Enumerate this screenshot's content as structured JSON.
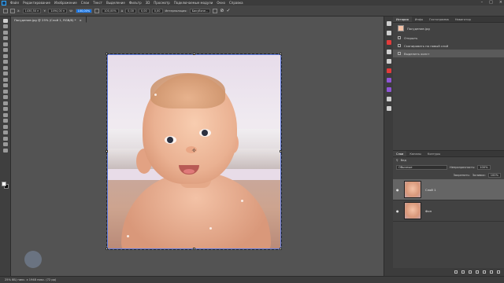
{
  "menu": {
    "items": [
      "Файл",
      "Редактирование",
      "Изображение",
      "Слои",
      "Текст",
      "Выделение",
      "Фильтр",
      "3D",
      "Просмотр",
      "Подключаемые модули",
      "Окно",
      "Справка"
    ],
    "window_controls": [
      "–",
      "□",
      "×"
    ]
  },
  "options": {
    "x_label": "X:",
    "x_value": "1430,50 п",
    "y_label": "Y:",
    "y_value": "1494,00 п",
    "w_label": "W:",
    "w_value": "100,00%",
    "h_value": "100,00%",
    "angle_label": "∆",
    "angle_value": "0,00",
    "h_skew": "0,00",
    "v_skew": "0,00",
    "interp_label": "Интерполяция:",
    "interp_value": "Бикубиче...",
    "cancel": "⊘",
    "commit": "✓"
  },
  "document": {
    "tab_title": "Посудение.jpg @ 25% (Слой 1, RGB/8) *",
    "tab_close": "×"
  },
  "status": {
    "text": "25%   8Б) пикс. х 1948 пикс. (72 pp)"
  },
  "history": {
    "tabs": [
      "История",
      "Инфо",
      "Гистограмма",
      "Навигатор"
    ],
    "snapshot": "Посудение.jpg",
    "items": [
      "Открыть",
      "Скопировать на новый слой",
      "Выделить холст"
    ]
  },
  "layers": {
    "tabs": [
      "Слои",
      "Каналы",
      "Контуры"
    ],
    "kind_label": "Вид",
    "blend_mode": "Обычные",
    "opacity_label": "Непрозрачность:",
    "opacity_value": "100%",
    "lock_label": "Закрепить:",
    "fill_label": "Заливка:",
    "fill_value": "100%",
    "items": [
      {
        "name": "Слой 1",
        "selected": true
      },
      {
        "name": "Фон",
        "selected": false
      }
    ]
  },
  "colors": {
    "accent": "#1473e6",
    "selected_layer": "#656565",
    "panel_bg": "#424242"
  }
}
